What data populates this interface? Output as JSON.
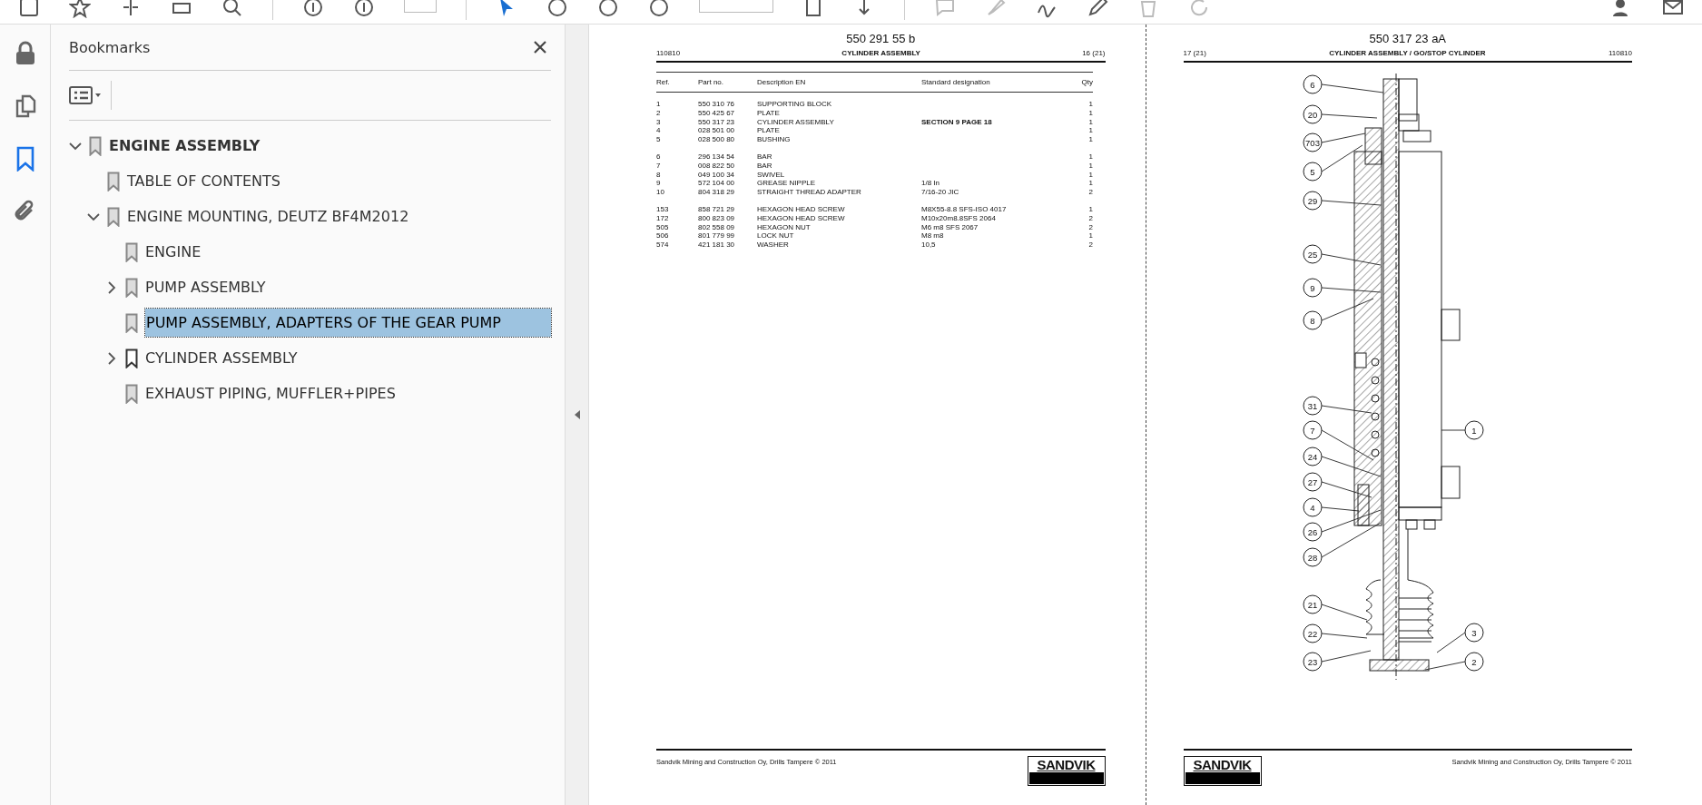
{
  "sidebar": {
    "rail": [
      {
        "kind": "lock",
        "selected": false
      },
      {
        "kind": "pages",
        "selected": false
      },
      {
        "kind": "bookmarks",
        "selected": true
      },
      {
        "kind": "attachments",
        "selected": false
      }
    ],
    "panel_title": "Bookmarks",
    "tree": [
      {
        "label": "ENGINE ASSEMBLY",
        "expanded": true,
        "selected": false,
        "current": false,
        "children": [
          {
            "label": "TABLE OF CONTENTS",
            "selected": false,
            "current": false
          },
          {
            "label": "ENGINE MOUNTING, DEUTZ BF4M2012",
            "expanded": true,
            "selected": false,
            "current": false,
            "children": [
              {
                "label": "ENGINE",
                "selected": false,
                "current": false
              },
              {
                "label": "PUMP ASSEMBLY",
                "expanded": false,
                "selected": false,
                "current": false
              },
              {
                "label": "PUMP ASSEMBLY, ADAPTERS OF THE GEAR PUMP",
                "selected": true,
                "current": false
              },
              {
                "label": "CYLINDER ASSEMBLY",
                "expanded": false,
                "selected": false,
                "current": true
              },
              {
                "label": "EXHAUST PIPING, MUFFLER+PIPES",
                "selected": false,
                "current": false
              }
            ]
          }
        ]
      }
    ]
  },
  "pages": [
    {
      "kind": "parts_list",
      "mirrored": false,
      "doc_number": "550 291 55 b",
      "date": "110810",
      "heading": "CYLINDER ASSEMBLY",
      "page_ref": "16 (21)",
      "columns": [
        "Ref.",
        "Part no.",
        "Description EN",
        "Standard designation",
        "Qty"
      ],
      "row_groups": [
        [
          {
            "ref": "1",
            "part": "550 310 76",
            "description": "SUPPORTING BLOCK",
            "qty": "1"
          },
          {
            "ref": "2",
            "part": "550 425 67",
            "description": "PLATE",
            "qty": "1"
          },
          {
            "ref": "3",
            "part": "550 317 23",
            "description": "CYLINDER ASSEMBLY",
            "designation": "SECTION 9 PAGE 18",
            "bold_designation": true,
            "qty": "1"
          },
          {
            "ref": "4",
            "part": "028 501 00",
            "description": "PLATE",
            "qty": "1"
          },
          {
            "ref": "5",
            "part": "028 500 80",
            "description": "BUSHING",
            "qty": "1"
          }
        ],
        [
          {
            "ref": "6",
            "part": "296 134 54",
            "description": "BAR",
            "qty": "1"
          },
          {
            "ref": "7",
            "part": "008 822 50",
            "description": "BAR",
            "qty": "1"
          },
          {
            "ref": "8",
            "part": "049 100 34",
            "description": "SWIVEL",
            "qty": "1"
          },
          {
            "ref": "9",
            "part": "572 104 00",
            "description": "GREASE NIPPLE",
            "designation": "1/8 In",
            "bold_designation": false,
            "qty": "1"
          },
          {
            "ref": "10",
            "part": "804 318 29",
            "description": "STRAIGHT THREAD ADAPTER",
            "designation": "7/16-20 JIC",
            "bold_designation": false,
            "qty": "2"
          }
        ],
        [
          {
            "ref": "153",
            "part": "858 721 29",
            "description": "HEXAGON HEAD SCREW",
            "designation": "M8X55-8.8 SFS-ISO 4017",
            "bold_designation": false,
            "qty": "1"
          },
          {
            "ref": "172",
            "part": "800 823 09",
            "description": "HEXAGON HEAD SCREW",
            "designation": "M10x20m8.8SFS 2064",
            "bold_designation": false,
            "qty": "2"
          },
          {
            "ref": "505",
            "part": "802 558 09",
            "description": "HEXAGON NUT",
            "designation": "M6 m8 SFS 2067",
            "bold_designation": false,
            "qty": "2"
          },
          {
            "ref": "506",
            "part": "801 779 99",
            "description": "LOCK NUT",
            "designation": "M8 m8",
            "bold_designation": false,
            "qty": "1"
          },
          {
            "ref": "574",
            "part": "421 181 30",
            "description": "WASHER",
            "designation": "10,5",
            "bold_designation": false,
            "qty": "2"
          }
        ]
      ],
      "footer_text": "Sandvik Mining and Construction Oy, Drills Tampere © 2011",
      "logo": "SANDVIK"
    },
    {
      "kind": "drawing",
      "mirrored": true,
      "doc_number": "550 317 23 aA",
      "date": "110810",
      "heading": "CYLINDER ASSEMBLY / GO/STOP CYLINDER",
      "page_ref": "17 (21)",
      "callouts": [
        "6",
        "20",
        "703",
        "5",
        "29",
        "25",
        "9",
        "8",
        "31",
        "7",
        "24",
        "27",
        "4",
        "26",
        "28",
        "21",
        "22",
        "23",
        "1",
        "3",
        "2"
      ],
      "footer_text": "Sandvik Mining and Construction Oy, Drills Tampere © 2011",
      "logo": "SANDVIK"
    }
  ]
}
